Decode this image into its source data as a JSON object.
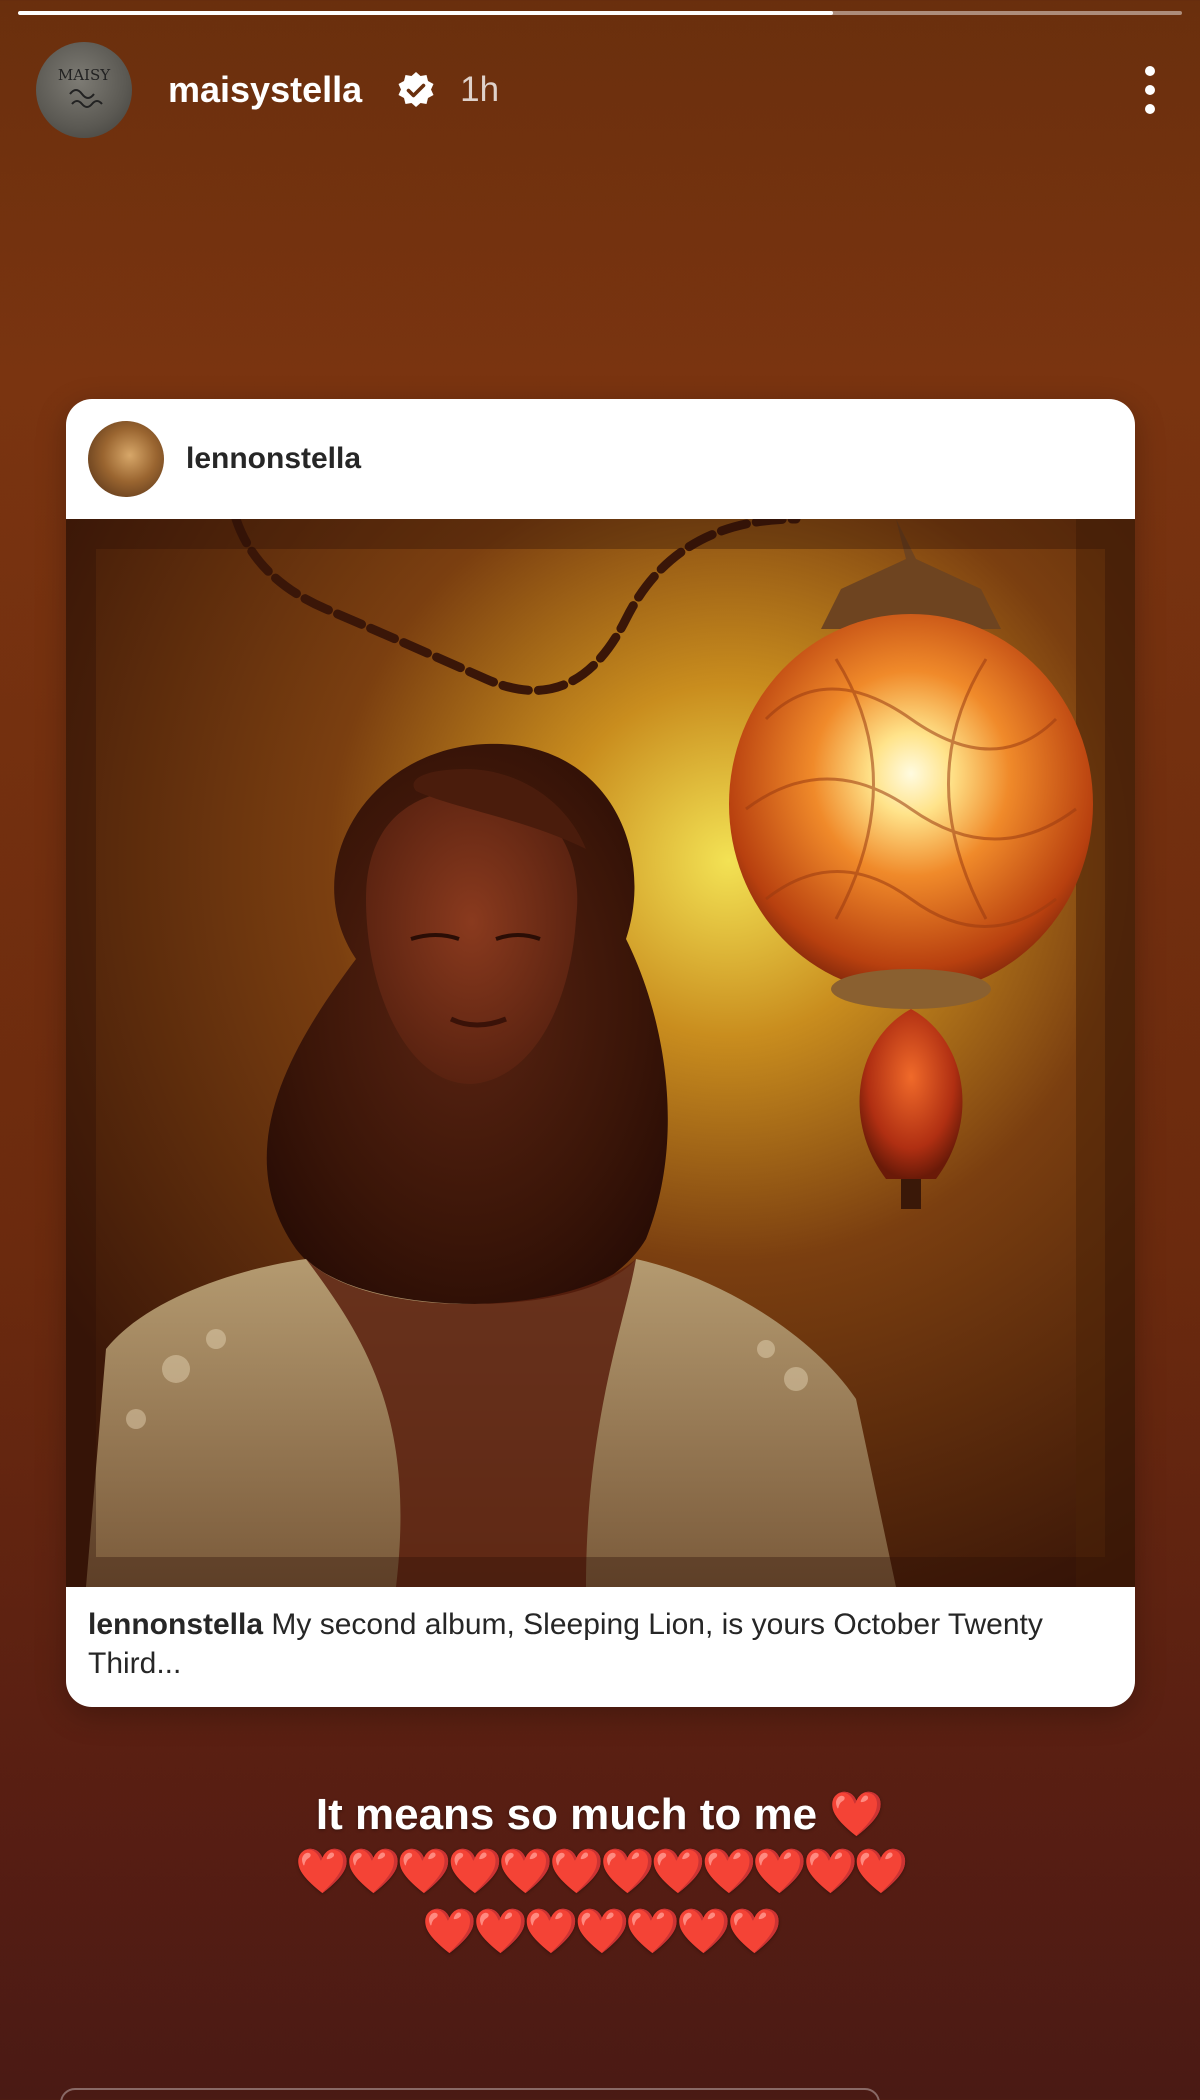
{
  "story": {
    "progress": 0.7,
    "username": "maisystella",
    "time": "1h",
    "avatar_text": "MAISY",
    "verified": true
  },
  "shared_post": {
    "username": "lennonstella",
    "caption_user": "lennonstella",
    "caption_text": " My second album, Sleeping Lion, is yours October Twenty Third..."
  },
  "overlay_text": {
    "line1": "It means so much to me ❤️",
    "line2": "❤️❤️❤️❤️❤️❤️❤️❤️❤️❤️❤️❤️",
    "line3": "❤️❤️❤️❤️❤️❤️❤️"
  },
  "colors": {
    "background_top": "#6a2f0d",
    "background_bottom": "#4a1a14",
    "verified_badge": "#ffffff"
  }
}
